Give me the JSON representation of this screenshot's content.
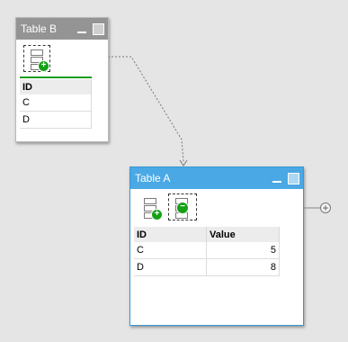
{
  "connector": {
    "color": "#777777"
  },
  "table_b": {
    "title": "Table B",
    "toolbar": [
      {
        "icon": "add-rows-icon",
        "selected": true
      }
    ],
    "columns": [
      "ID"
    ],
    "rows": [
      [
        "C"
      ],
      [
        "D"
      ]
    ]
  },
  "table_a": {
    "title": "Table A",
    "toolbar": [
      {
        "icon": "add-rows-icon",
        "selected": false
      },
      {
        "icon": "remove-rows-icon",
        "selected": true
      }
    ],
    "columns": [
      "ID",
      "Value"
    ],
    "rows": [
      [
        "C",
        "5"
      ],
      [
        "D",
        "8"
      ]
    ]
  },
  "side_button": {
    "symbol": "+"
  },
  "colors": {
    "inactive_titlebar": "#949494",
    "active_titlebar": "#4aa8e4",
    "badge_green": "#16a018"
  }
}
